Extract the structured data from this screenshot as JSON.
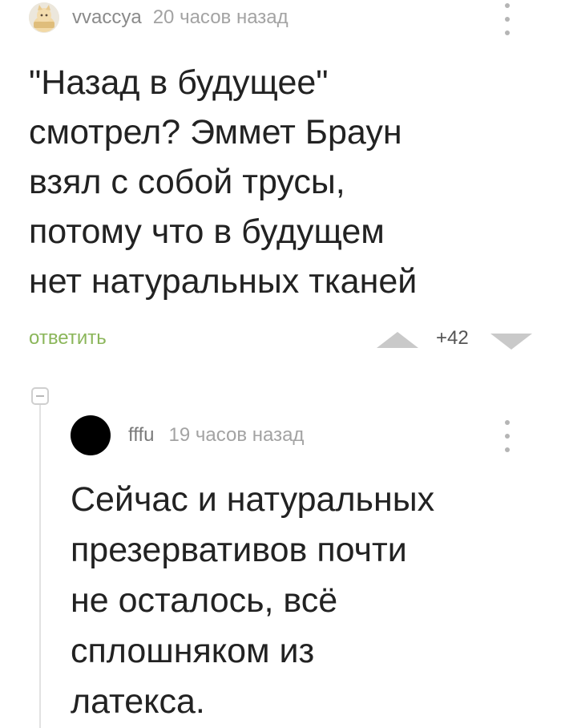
{
  "comment": {
    "author": "vvaccya",
    "time": "20 часов назад",
    "avatar_icon": "cat-avatar-icon",
    "text": "\"Назад в будущее\"\nсмотрел? Эммет Браун\nвзял с собой трусы,\nпотому что в будущем\nнет натуральных тканей",
    "reply_label": "ответить",
    "rating": "+42"
  },
  "reply": {
    "author": "fffu",
    "time": "19 часов назад",
    "avatar_icon": "black-circle-avatar-icon",
    "text": "Сейчас и натуральных\nпрезервативов почти\nне осталось, всё\nсплошняком из\nлатекса."
  },
  "colors": {
    "accent_green": "#8bb65a",
    "text_main": "#222222",
    "text_muted": "#a3a3a3",
    "vote_arrow": "#c9c9c9"
  }
}
